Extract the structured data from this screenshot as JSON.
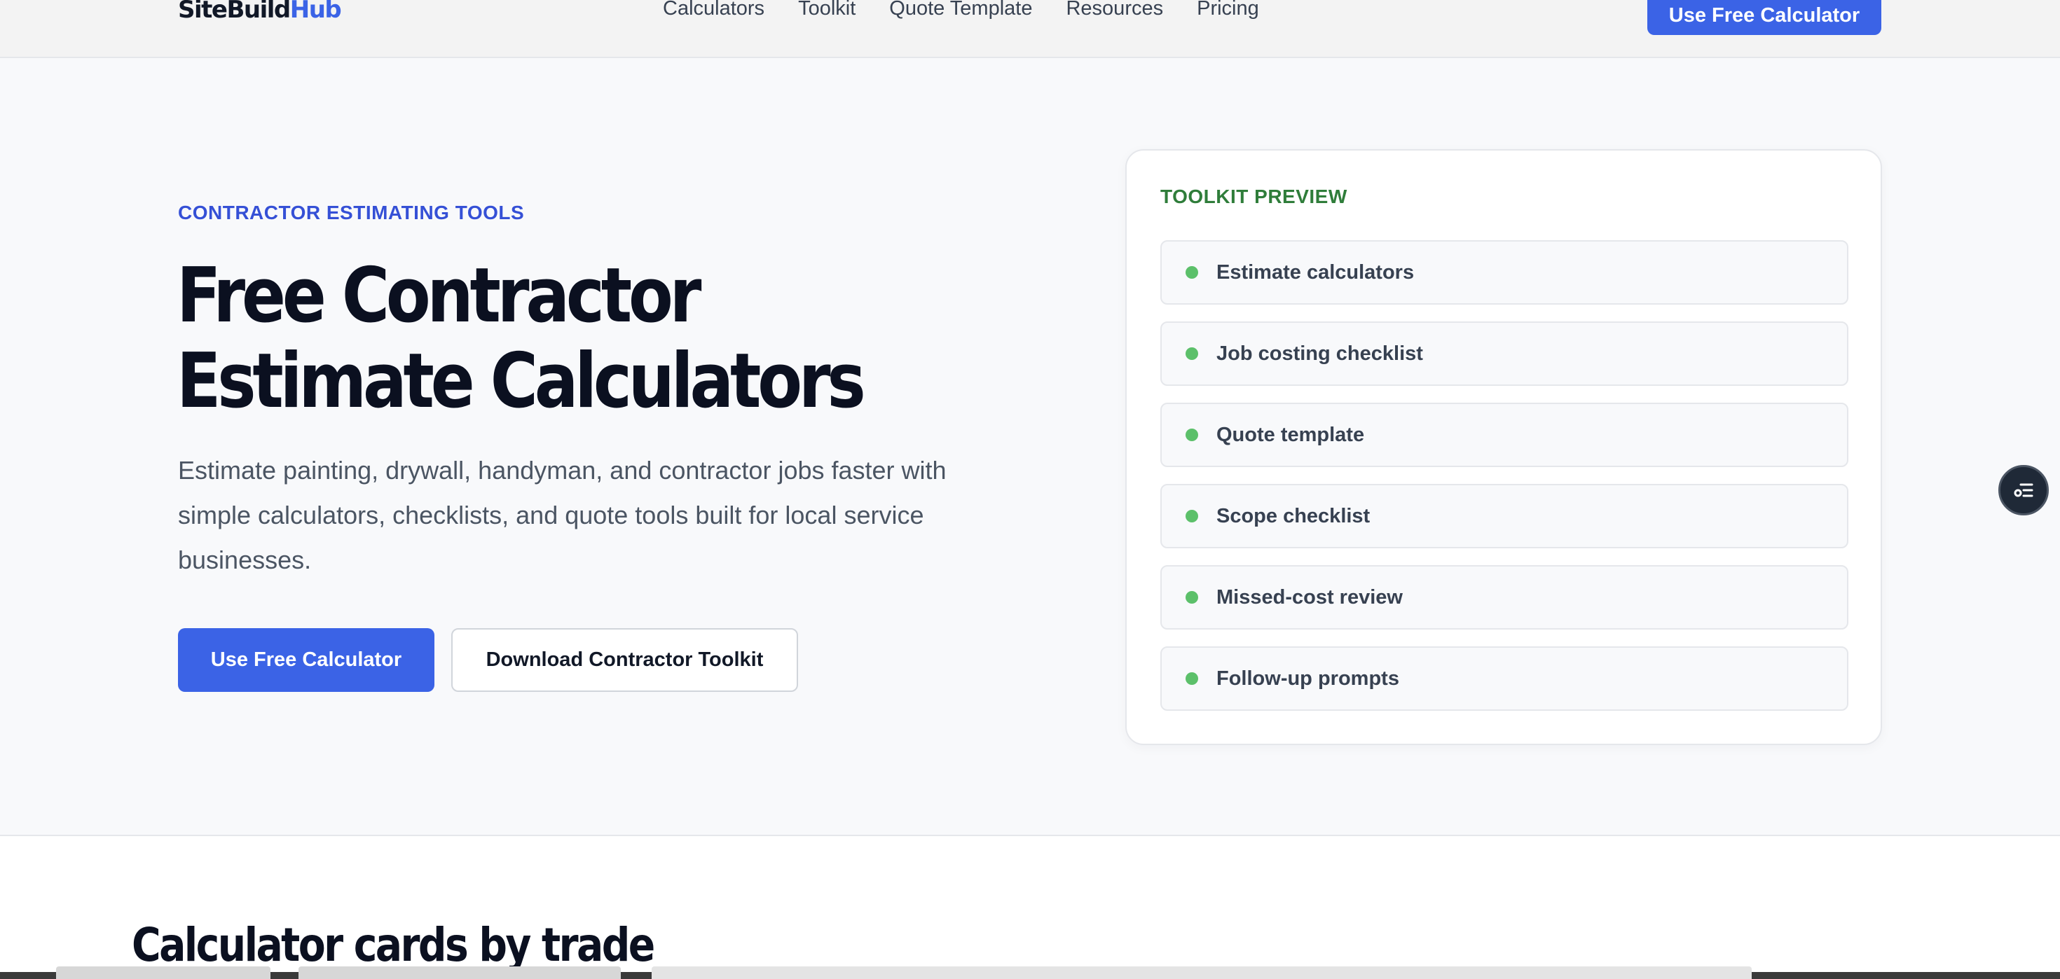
{
  "header": {
    "logo_part1": "SiteBuild",
    "logo_part2": "Hub",
    "nav": [
      "Calculators",
      "Toolkit",
      "Quote Template",
      "Resources",
      "Pricing"
    ],
    "cta": "Use Free Calculator"
  },
  "hero": {
    "eyebrow": "CONTRACTOR ESTIMATING TOOLS",
    "title": "Free Contractor Estimate Calculators",
    "subtitle": "Estimate painting, drywall, handyman, and contractor jobs faster with simple calculators, checklists, and quote tools built for local service businesses.",
    "primary_button": "Use Free Calculator",
    "secondary_button": "Download Contractor Toolkit"
  },
  "toolkit_preview": {
    "label": "TOOLKIT PREVIEW",
    "items": [
      "Estimate calculators",
      "Job costing checklist",
      "Quote template",
      "Scope checklist",
      "Missed-cost review",
      "Follow-up prompts"
    ]
  },
  "floating_button": {
    "icon": "list-settings-icon"
  },
  "section": {
    "title": "Calculator cards by trade"
  },
  "colors": {
    "brand_blue": "#3b63e6",
    "eyebrow_blue": "#3550d6",
    "preview_green": "#2f7d3a",
    "dot_green": "#5cc06a"
  }
}
